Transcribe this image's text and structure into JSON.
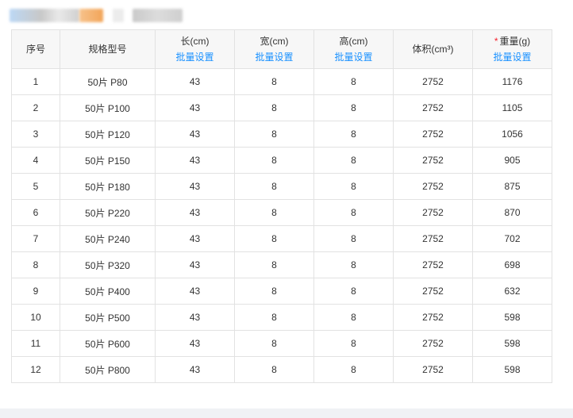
{
  "headers": {
    "index": "序号",
    "spec": "规格型号",
    "length": "长(cm)",
    "width": "宽(cm)",
    "height": "高(cm)",
    "volume": "体积(cm³)",
    "weight_required_mark": "*",
    "weight": "重量(g)",
    "batch_set": "批量设置"
  },
  "rows": [
    {
      "no": "1",
      "spec": "50片 P80",
      "length": "43",
      "width": "8",
      "height": "8",
      "volume": "2752",
      "weight": "1176"
    },
    {
      "no": "2",
      "spec": "50片 P100",
      "length": "43",
      "width": "8",
      "height": "8",
      "volume": "2752",
      "weight": "1105"
    },
    {
      "no": "3",
      "spec": "50片 P120",
      "length": "43",
      "width": "8",
      "height": "8",
      "volume": "2752",
      "weight": "1056"
    },
    {
      "no": "4",
      "spec": "50片 P150",
      "length": "43",
      "width": "8",
      "height": "8",
      "volume": "2752",
      "weight": "905"
    },
    {
      "no": "5",
      "spec": "50片 P180",
      "length": "43",
      "width": "8",
      "height": "8",
      "volume": "2752",
      "weight": "875"
    },
    {
      "no": "6",
      "spec": "50片 P220",
      "length": "43",
      "width": "8",
      "height": "8",
      "volume": "2752",
      "weight": "870"
    },
    {
      "no": "7",
      "spec": "50片 P240",
      "length": "43",
      "width": "8",
      "height": "8",
      "volume": "2752",
      "weight": "702"
    },
    {
      "no": "8",
      "spec": "50片 P320",
      "length": "43",
      "width": "8",
      "height": "8",
      "volume": "2752",
      "weight": "698"
    },
    {
      "no": "9",
      "spec": "50片 P400",
      "length": "43",
      "width": "8",
      "height": "8",
      "volume": "2752",
      "weight": "632"
    },
    {
      "no": "10",
      "spec": "50片 P500",
      "length": "43",
      "width": "8",
      "height": "8",
      "volume": "2752",
      "weight": "598"
    },
    {
      "no": "11",
      "spec": "50片 P600",
      "length": "43",
      "width": "8",
      "height": "8",
      "volume": "2752",
      "weight": "598"
    },
    {
      "no": "12",
      "spec": "50片 P800",
      "length": "43",
      "width": "8",
      "height": "8",
      "volume": "2752",
      "weight": "598"
    }
  ],
  "colors": {
    "link": "#1890ff",
    "required": "#f5222d",
    "header_bg": "#f7f7f7",
    "border": "#e2e2e2"
  }
}
